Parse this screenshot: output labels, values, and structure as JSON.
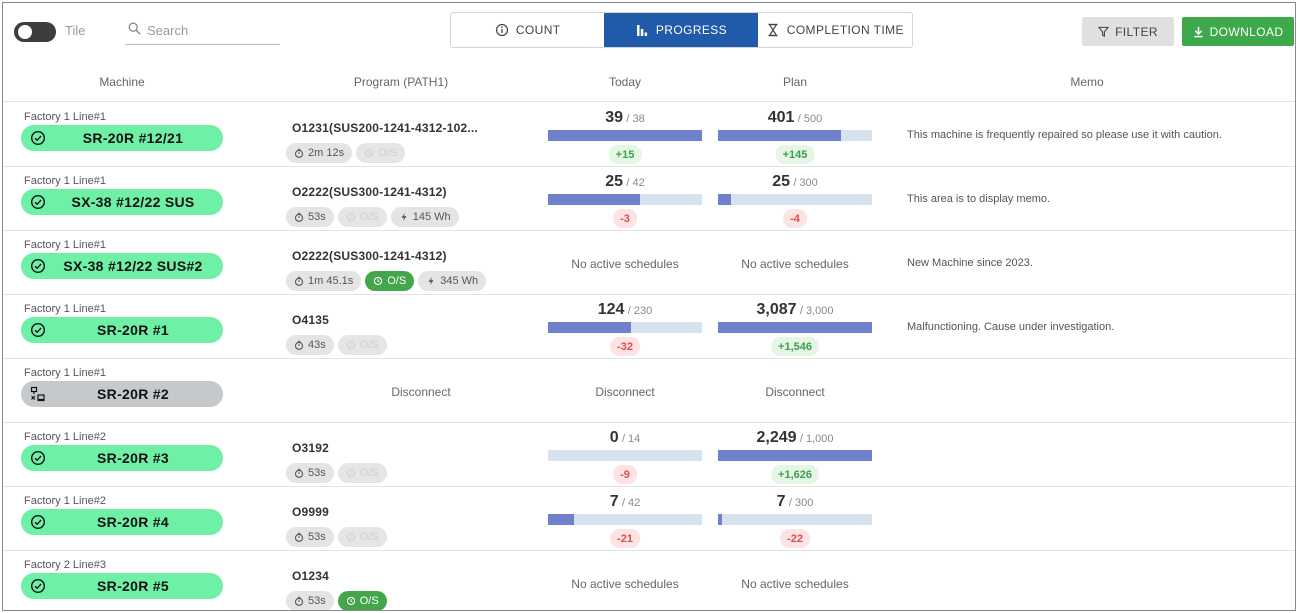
{
  "toolbar": {
    "tile_label": "Tile",
    "search_placeholder": "Search",
    "tabs": [
      {
        "label": "COUNT",
        "icon": "info-circle-icon"
      },
      {
        "label": "PROGRESS",
        "icon": "bar-chart-icon"
      },
      {
        "label": "COMPLETION TIME",
        "icon": "hourglass-icon"
      }
    ],
    "active_tab": "PROGRESS",
    "filter_label": "FILTER",
    "download_label": "DOWNLOAD"
  },
  "colors": {
    "active_tab": "#1f5ba8",
    "download": "#3ea94b",
    "machine_online": "#6ef0a7",
    "machine_offline": "#c6c9cc",
    "bar_fill": "#6f80cd",
    "bar_track": "#d8e2ef"
  },
  "columns": [
    "Machine",
    "Program (PATH1)",
    "Today",
    "Plan",
    "Memo"
  ],
  "rows": [
    {
      "factory": "Factory 1 Line#1",
      "machine": "SR-20R #12/21",
      "status": "online",
      "program": "O1231(SUS200-1241-4312-102...",
      "time": "2m 12s",
      "os": "O/S",
      "os_active": false,
      "energy": null,
      "today": {
        "value": "39",
        "target": "/ 38",
        "diff": "+15",
        "fill": 1.0
      },
      "plan": {
        "value": "401",
        "target": "/ 500",
        "diff": "+145",
        "fill": 0.8
      },
      "memo": "This machine is frequently repaired so please use it with caution."
    },
    {
      "factory": "Factory 1 Line#1",
      "machine": "SX-38 #12/22 SUS",
      "status": "online",
      "program": "O2222(SUS300-1241-4312)",
      "time": "53s",
      "os": "O/S",
      "os_active": false,
      "energy": "145 Wh",
      "today": {
        "value": "25",
        "target": "/ 42",
        "diff": "-3",
        "fill": 0.595
      },
      "plan": {
        "value": "25",
        "target": "/ 300",
        "diff": "-4",
        "fill": 0.083
      },
      "memo": "This area is to display memo."
    },
    {
      "factory": "Factory 1 Line#1",
      "machine": "SX-38 #12/22 SUS#2",
      "status": "online",
      "program": "O2222(SUS300-1241-4312)",
      "time": "1m 45.1s",
      "os": "O/S",
      "os_active": true,
      "energy": "345 Wh",
      "today_text": "No active schedules",
      "plan_text": "No active schedules",
      "memo": "New Machine since 2023."
    },
    {
      "factory": "Factory 1 Line#1",
      "machine": "SR-20R #1",
      "status": "online",
      "program": "O4135",
      "time": "43s",
      "os": "O/S",
      "os_active": false,
      "energy": null,
      "today": {
        "value": "124",
        "target": "/ 230",
        "diff": "-32",
        "fill": 0.539
      },
      "plan": {
        "value": "3,087",
        "target": "/ 3,000",
        "diff": "+1,546",
        "fill": 1.0
      },
      "memo": "Malfunctioning. Cause under investigation."
    },
    {
      "factory": "Factory 1 Line#1",
      "machine": "SR-20R #2",
      "status": "disconnected",
      "program_text": "Disconnect",
      "today_text": "Disconnect",
      "plan_text": "Disconnect",
      "memo": ""
    },
    {
      "factory": "Factory 1 Line#2",
      "machine": "SR-20R #3",
      "status": "online",
      "program": "O3192",
      "time": "53s",
      "os": "O/S",
      "os_active": false,
      "energy": null,
      "today": {
        "value": "0",
        "target": "/ 14",
        "diff": "-9",
        "fill": 0.0
      },
      "plan": {
        "value": "2,249",
        "target": "/ 1,000",
        "diff": "+1,626",
        "fill": 1.0
      },
      "memo": ""
    },
    {
      "factory": "Factory 1 Line#2",
      "machine": "SR-20R #4",
      "status": "online",
      "program": "O9999",
      "time": "53s",
      "os": "O/S",
      "os_active": false,
      "energy": null,
      "today": {
        "value": "7",
        "target": "/ 42",
        "diff": "-21",
        "fill": 0.167
      },
      "plan": {
        "value": "7",
        "target": "/ 300",
        "diff": "-22",
        "fill": 0.023
      },
      "memo": ""
    },
    {
      "factory": "Factory 2 Line#3",
      "machine": "SR-20R #5",
      "status": "online",
      "program": "O1234",
      "time": "53s",
      "os": "O/S",
      "os_active": true,
      "energy": null,
      "today_text": "No active schedules",
      "plan_text": "No active schedules",
      "memo": ""
    }
  ]
}
